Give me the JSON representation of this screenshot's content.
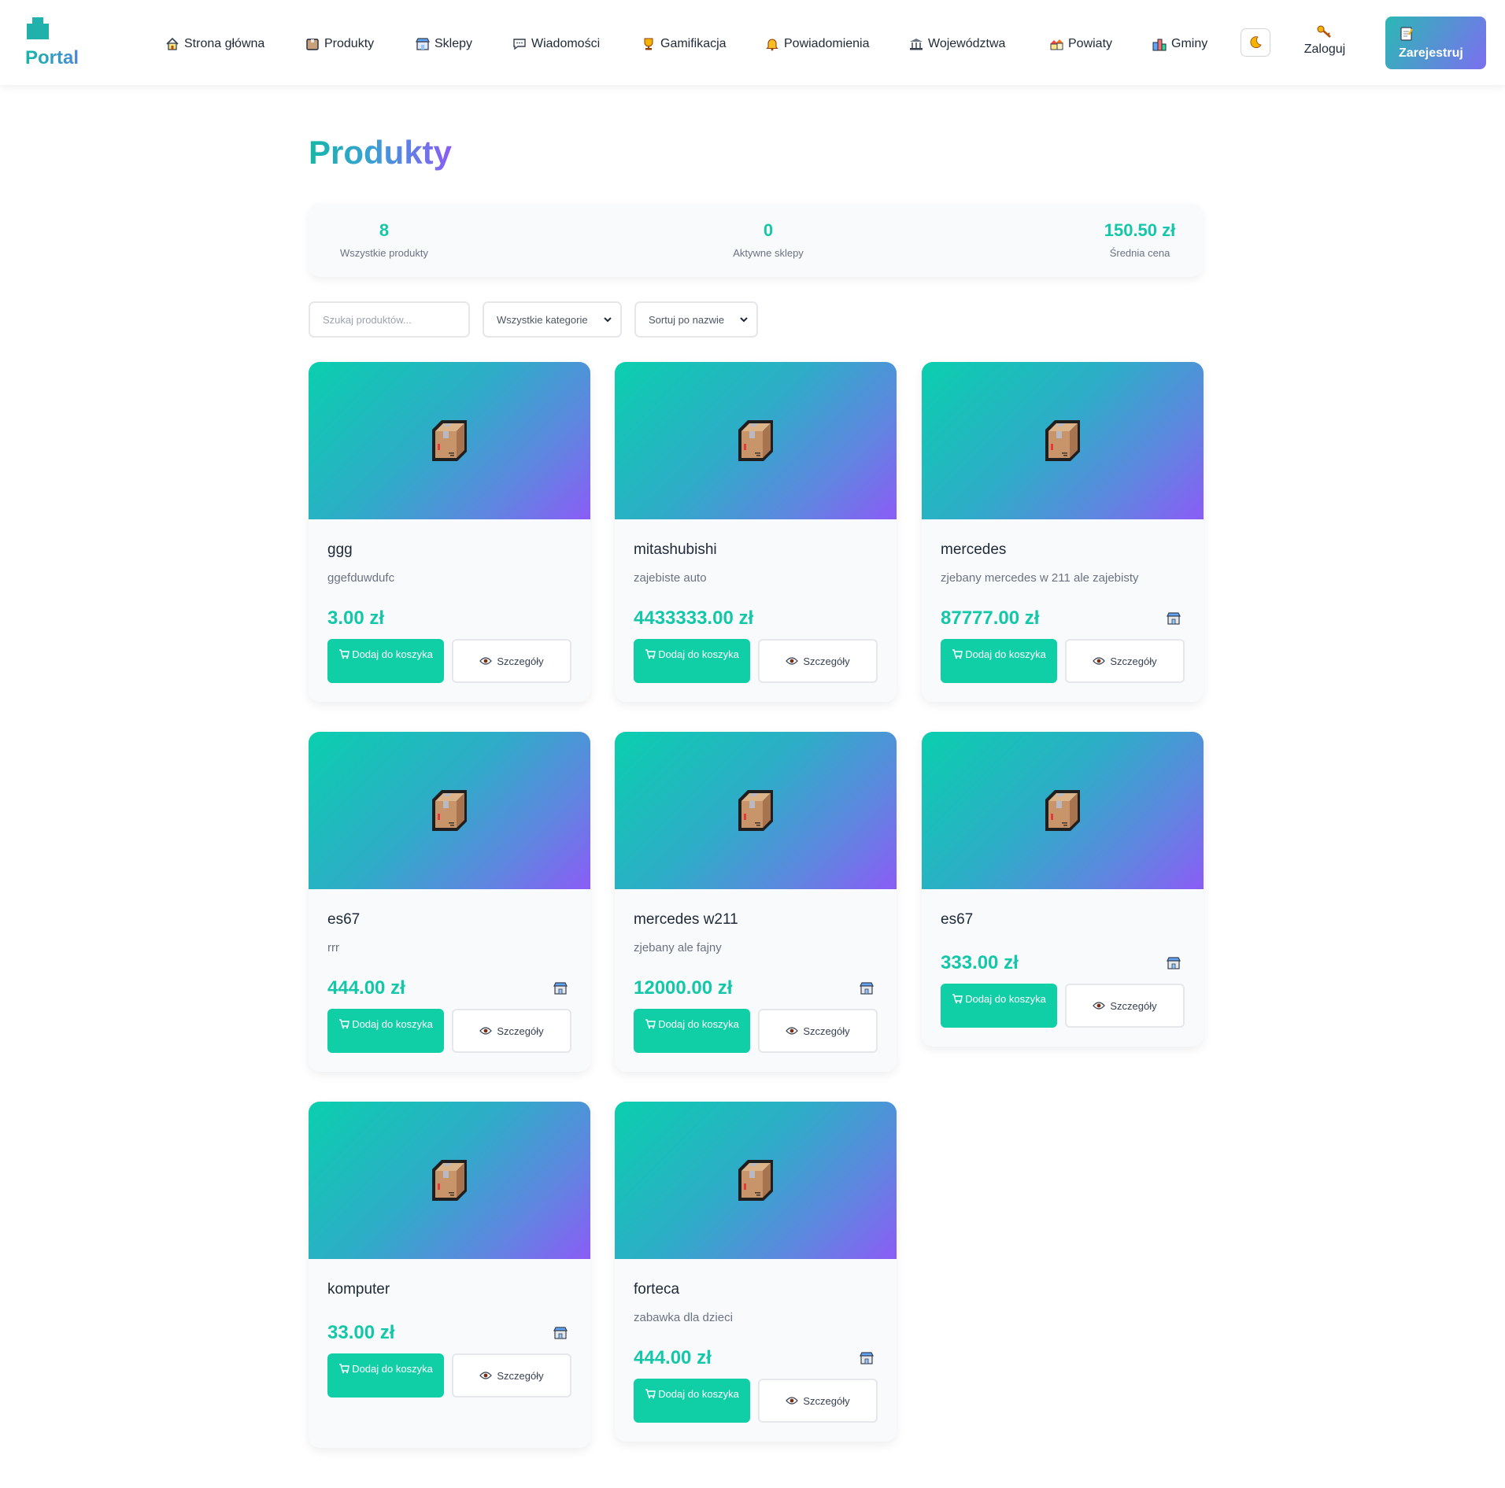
{
  "header": {
    "logo_text": "Portal",
    "nav": [
      {
        "label": "Strona główna",
        "icon": "home-icon"
      },
      {
        "label": "Produkty",
        "icon": "box-icon"
      },
      {
        "label": "Sklepy",
        "icon": "store-icon"
      },
      {
        "label": "Wiadomości",
        "icon": "message-icon"
      },
      {
        "label": "Gamifikacja",
        "icon": "trophy-icon"
      },
      {
        "label": "Powiadomienia",
        "icon": "bell-icon"
      },
      {
        "label": "Województwa",
        "icon": "building-icon"
      },
      {
        "label": "Powiaty",
        "icon": "houses-icon"
      },
      {
        "label": "Gminy",
        "icon": "city-icon"
      }
    ],
    "login_label": "Zaloguj",
    "register_label": "Zarejestruj"
  },
  "page": {
    "title": "Produkty"
  },
  "stats": [
    {
      "value": "8",
      "label": "Wszystkie produkty"
    },
    {
      "value": "0",
      "label": "Aktywne sklepy"
    },
    {
      "value": "150.50 zł",
      "label": "Średnia cena"
    }
  ],
  "filters": {
    "search_placeholder": "Szukaj produktów...",
    "category_selected": "Wszystkie kategorie",
    "sort_selected": "Sortuj po nazwie"
  },
  "card_buttons": {
    "add_to_cart": "Dodaj do koszyka",
    "details": "Szczegóły"
  },
  "products": [
    {
      "name": "ggg",
      "description": "ggefduwdufc",
      "price": "3.00 zł",
      "has_store": false
    },
    {
      "name": "mitashubishi",
      "description": "zajebiste auto",
      "price": "4433333.00 zł",
      "has_store": false
    },
    {
      "name": "mercedes",
      "description": "zjebany mercedes w 211 ale zajebisty",
      "price": "87777.00 zł",
      "has_store": true
    },
    {
      "name": "es67",
      "description": "rrr",
      "price": "444.00 zł",
      "has_store": true
    },
    {
      "name": "mercedes w211",
      "description": "zjebany ale fajny",
      "price": "12000.00 zł",
      "has_store": true
    },
    {
      "name": "es67",
      "description": "",
      "price": "333.00 zł",
      "has_store": true
    },
    {
      "name": "komputer",
      "description": "",
      "price": "33.00 zł",
      "has_store": true
    },
    {
      "name": "forteca",
      "description": "zabawka dla dzieci",
      "price": "444.00 zł",
      "has_store": true
    }
  ],
  "colors": {
    "accent": "#14c7a8",
    "cart_button": "#10cfa6",
    "gradient_start": "#0acfae",
    "gradient_end": "#8b5cf6"
  }
}
